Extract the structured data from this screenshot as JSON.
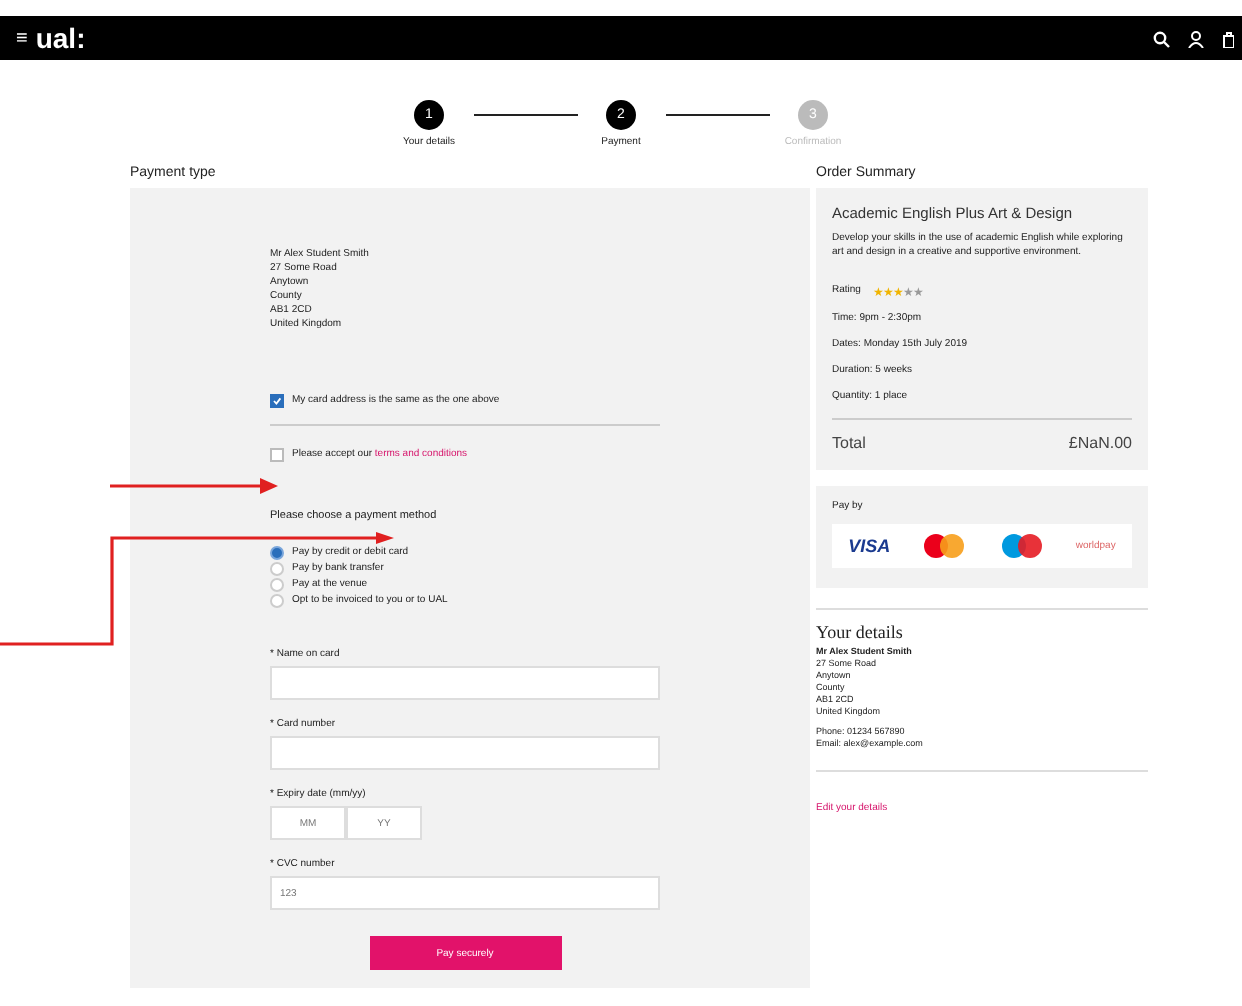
{
  "header": {
    "menu_glyph": "≡",
    "logo": "ual:"
  },
  "steps": [
    {
      "number": "1",
      "label": "Your details",
      "done": true
    },
    {
      "number": "2",
      "label": "Payment",
      "done": true
    },
    {
      "number": "3",
      "label": "Confirmation",
      "done": false
    }
  ],
  "payment": {
    "title": "Payment type",
    "address": [
      "Mr Alex Student Smith",
      "27 Some Road",
      "Anytown",
      "County",
      "AB1 2CD",
      "United Kingdom"
    ],
    "checkboxes": [
      {
        "text": "My card address is the same as the one above",
        "checked": true,
        "divider_after": true
      },
      {
        "text": "Please accept our **terms and conditions**",
        "checked": false,
        "divider_after": false
      }
    ],
    "method_label": "Please choose a payment method",
    "methods": [
      {
        "label": "Pay by credit or debit card",
        "selected": true
      },
      {
        "label": "Pay by bank transfer",
        "selected": false
      },
      {
        "label": "Pay at the venue",
        "selected": false
      },
      {
        "label": "Opt to be invoiced to you or to UAL",
        "selected": false
      }
    ],
    "fields": [
      {
        "kind": "text",
        "label": "* Name on card"
      },
      {
        "kind": "text",
        "label": "* Card number"
      },
      {
        "kind": "pair",
        "label": "* Expiry date (mm/yy)",
        "placeholders": [
          "MM",
          "YY"
        ]
      },
      {
        "kind": "text",
        "label": "* CVC number",
        "placeholder": "123"
      }
    ],
    "submit": "Pay securely"
  },
  "summary": {
    "title": "Order Summary",
    "course": "Academic English Plus Art & Design",
    "description": "Develop your skills in the use of academic English while exploring art and design in a creative and supportive environment.",
    "rating": {
      "label": "Rating",
      "stars": 3
    },
    "facts": [
      "Time: 9pm - 2:30pm",
      "Dates: Monday 15th July 2019",
      "Duration: 5 weeks",
      "Quantity: 1 place"
    ],
    "total_label": "Total",
    "total": "£NaN.00",
    "pay_by": "Pay by",
    "cards": [
      {
        "kind": "visa",
        "text": "VISA"
      },
      {
        "kind": "mastercard"
      },
      {
        "kind": "maestro"
      },
      {
        "kind": "worldpay",
        "text": "worldpay"
      }
    ]
  },
  "details": {
    "title": "Your details",
    "lines": [
      "Mr Alex Student Smith",
      "27 Some Road",
      "Anytown",
      "County",
      "AB1 2CD",
      "United Kingdom"
    ],
    "contact": [
      "Phone: 01234 567890",
      "Email: alex@example.com"
    ],
    "edit_link": "Edit your details"
  }
}
